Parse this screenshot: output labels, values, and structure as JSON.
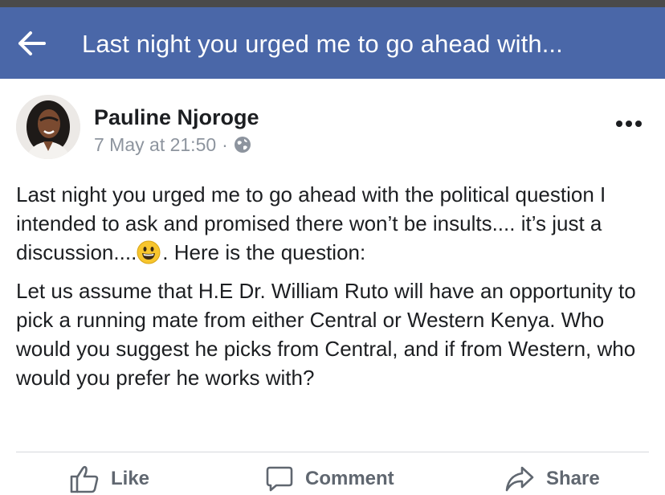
{
  "navbar": {
    "title": "Last night you urged me to go ahead with...",
    "back_icon": "arrow-left-icon",
    "background": "#4a67a8"
  },
  "post": {
    "author": "Pauline Njoroge",
    "timestamp": "7 May at 21:50",
    "separator": "·",
    "privacy_icon": "globe-icon",
    "more_icon": "more-options-icon",
    "paragraph1_before_emoji": "Last night you urged me to go ahead with the political question I intended to ask and promised there won’t be insults.... it’s just a discussion....",
    "emoji_icon": "grinning-face-emoji",
    "paragraph1_after_emoji": ". Here is the question:",
    "paragraph2": "Let us assume that H.E Dr. William Ruto will have an opportunity to pick a running mate from either Central or Western Kenya. Who would you suggest he picks from Central, and if from Western, who would you prefer he works with?"
  },
  "actions": {
    "like_label": "Like",
    "comment_label": "Comment",
    "share_label": "Share",
    "like_icon": "thumbs-up-icon",
    "comment_icon": "comment-icon",
    "share_icon": "share-arrow-icon"
  }
}
